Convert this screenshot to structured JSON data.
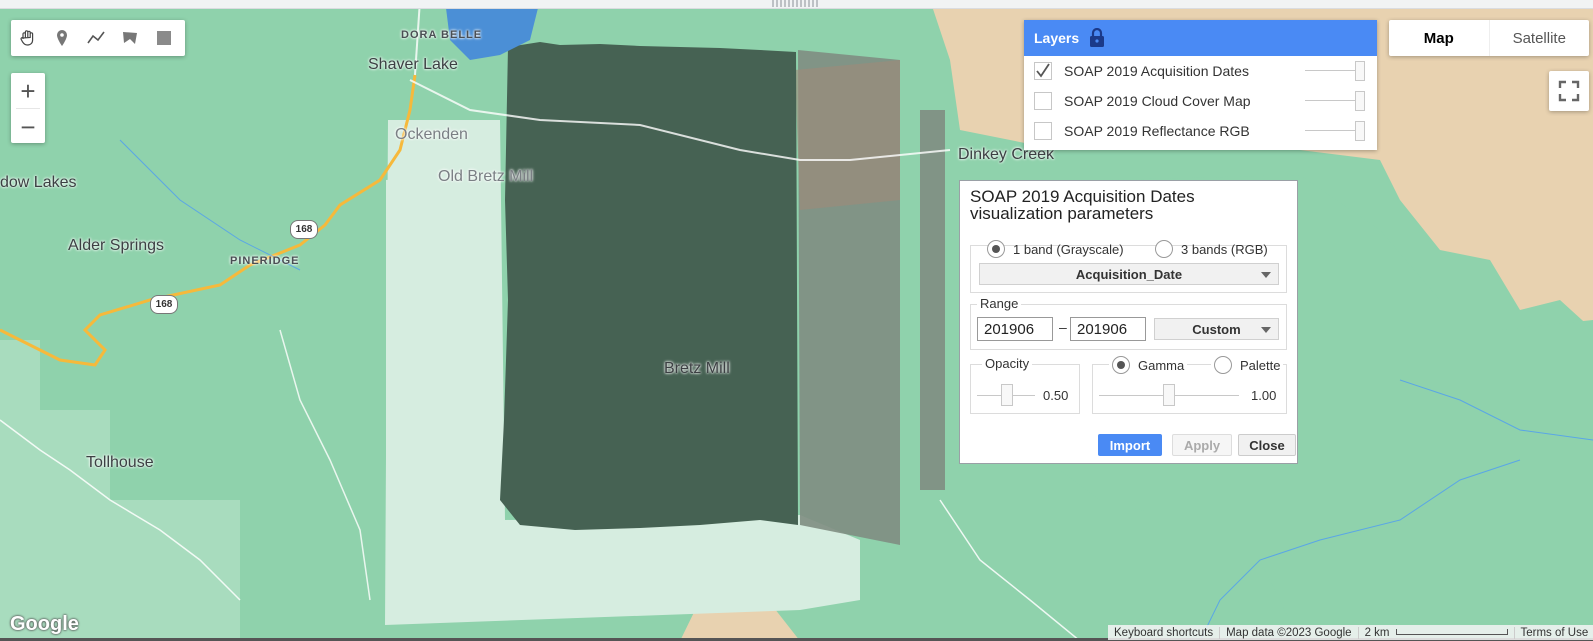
{
  "map": {
    "places": {
      "dora_belle": "DORA BELLE",
      "shaver_lake": "Shaver Lake",
      "ockenden": "Ockenden",
      "old_bretz_mill": "Old Bretz Mill",
      "dow_lakes": "dow Lakes",
      "alder_springs": "Alder Springs",
      "pineridge": "PINERIDGE",
      "bretz_mill": "Bretz Mill",
      "tollhouse": "Tollhouse",
      "dinkey_creek": "Dinkey Creek"
    },
    "route_shields": [
      "168",
      "168"
    ],
    "colors": {
      "forest": "#8fd2ac",
      "overlay_dark": "#466253",
      "overlay_light": "#d6ede0",
      "road": "#f6b93b",
      "terrain": "#e8d2b0",
      "water": "#4b8fd6"
    }
  },
  "drawing_tools": {
    "icons": [
      "hand-pan-icon",
      "point-marker-icon",
      "line-icon",
      "polygon-icon",
      "rectangle-icon"
    ]
  },
  "zoom": {
    "in_label": "+",
    "out_label": "−"
  },
  "map_type": {
    "map_label": "Map",
    "satellite_label": "Satellite",
    "selected": "Map"
  },
  "layers": {
    "title": "Layers",
    "accent": "#4a8af4",
    "items": [
      {
        "label": "SOAP 2019 Acquisition Dates",
        "checked": true
      },
      {
        "label": "SOAP 2019 Cloud Cover Map",
        "checked": false
      },
      {
        "label": "SOAP 2019 Reflectance RGB",
        "checked": false
      }
    ]
  },
  "viz": {
    "title": "SOAP 2019 Acquisition Dates visualization parameters",
    "band_mode_1": "1 band (Grayscale)",
    "band_mode_3": "3 bands (RGB)",
    "band_selected": "1 band (Grayscale)",
    "band": "Acquisition_Date",
    "range_label": "Range",
    "range_min": "201906",
    "range_sep": "–",
    "range_max": "201906",
    "range_mode": "Custom",
    "opacity_label": "Opacity",
    "opacity_value": "0.50",
    "gamma_label": "Gamma",
    "palette_label": "Palette",
    "gamma_value": "1.00",
    "import_label": "Import",
    "apply_label": "Apply",
    "close_label": "Close"
  },
  "attribution": {
    "keyboard": "Keyboard shortcuts",
    "data": "Map data ©2023 Google",
    "scale": "2 km",
    "terms": "Terms of Use",
    "logo": "Google"
  }
}
